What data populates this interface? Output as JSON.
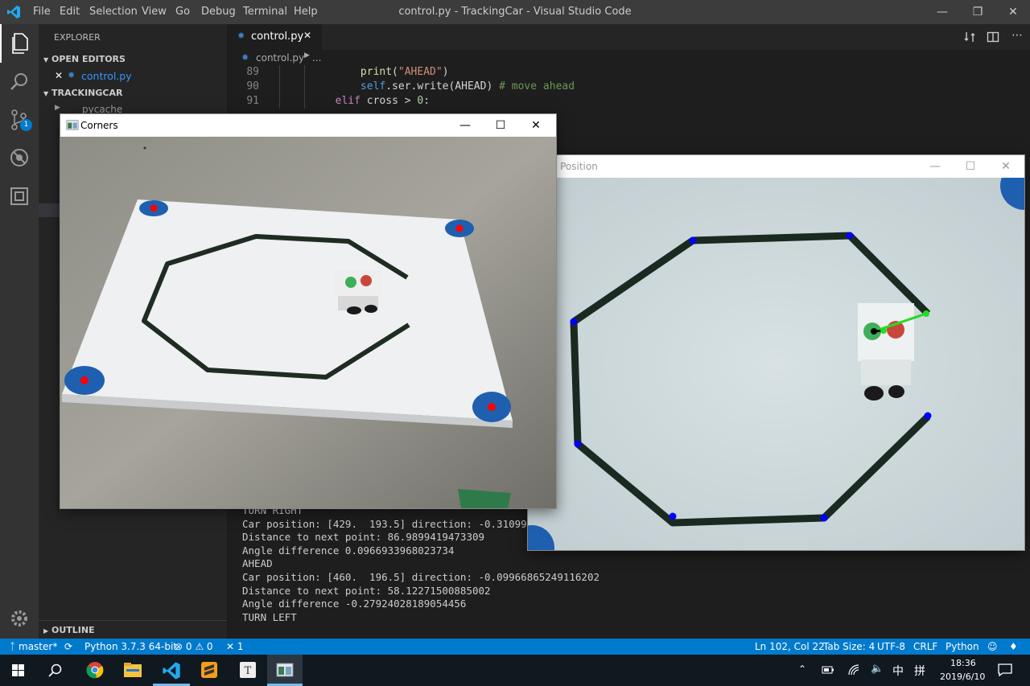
{
  "window": {
    "menu": [
      "File",
      "Edit",
      "Selection",
      "View",
      "Go",
      "Debug",
      "Terminal",
      "Help"
    ],
    "title": "control.py - TrackingCar - Visual Studio Code"
  },
  "sidebar": {
    "header": "EXPLORER",
    "open_editors": "OPEN EDITORS",
    "open_file": "control.py",
    "project": "TRACKINGCAR",
    "pycache": "__pycache__",
    "outline": "OUTLINE",
    "scm_badge": "1"
  },
  "editor": {
    "tab_label": "control.py",
    "breadcrumb": "control.py",
    "breadcrumb_more": "...",
    "lines": [
      {
        "num": "89",
        "indent": "            ",
        "parts": [
          {
            "t": "print(",
            "c": "#dcdcaa"
          },
          {
            "t": "\"AHEAD\"",
            "c": "#ce9178"
          },
          {
            "t": ")",
            "c": "#d4d4d4"
          }
        ]
      },
      {
        "num": "90",
        "indent": "            ",
        "parts": [
          {
            "t": "self",
            "c": "#569cd6"
          },
          {
            "t": ".ser.write(AHEAD) ",
            "c": "#d4d4d4"
          },
          {
            "t": "# move ahead",
            "c": "#6a9955"
          }
        ]
      },
      {
        "num": "91",
        "indent": "        ",
        "parts": [
          {
            "t": "elif",
            "c": "#c586c0"
          },
          {
            "t": " cross > ",
            "c": "#d4d4d4"
          },
          {
            "t": "0",
            "c": "#b5cea8"
          },
          {
            "t": ":",
            "c": "#d4d4d4"
          }
        ]
      }
    ]
  },
  "terminal": {
    "lines": [
      "TURN RIGHT",
      "Car position: [429.  193.5] direction: -0.3109982",
      "Distance to next point: 86.9899419473309",
      "Angle difference 0.0966933968023734",
      "AHEAD",
      "Car position: [460.  196.5] direction: -0.09966865249116202",
      "Distance to next point: 58.12271500885002",
      "Angle difference -0.27924028189054456",
      "TURN LEFT"
    ]
  },
  "statusbar": {
    "branch": "master*",
    "python": "Python 3.7.3 64-bit",
    "errors": "0",
    "warnings": "0",
    "tools": "1",
    "position": "Ln 102, Col 22",
    "tabsize": "Tab Size: 4",
    "encoding": "UTF-8",
    "eol": "CRLF",
    "language": "Python"
  },
  "corners_window": {
    "title": "Corners"
  },
  "carpos_window": {
    "title": "ar Position"
  },
  "taskbar": {
    "ime": "中",
    "ime2": "拼",
    "time": "18:36",
    "date": "2019/6/10"
  },
  "colors": {
    "accent": "#007acc",
    "activity": "#333333",
    "sidebar": "#252526",
    "editor": "#1e1e1e",
    "marker_red": "#ff0000",
    "marker_blue": "#1f5fb0",
    "waypoint_blue": "#0000ff",
    "heading_green": "#22dd22"
  }
}
